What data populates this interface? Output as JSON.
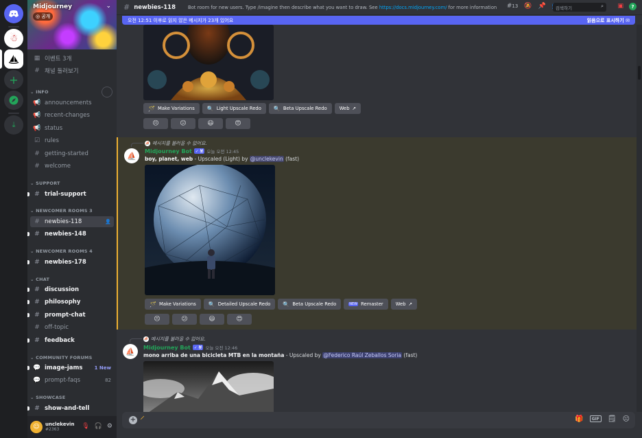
{
  "rail": {
    "icons": [
      "discord-home-icon",
      "ghost-server-icon",
      "midjourney-server-icon",
      "add-server-icon",
      "explore-icon",
      "download-icon"
    ]
  },
  "server": {
    "name": "Midjourney",
    "public_label": "공개"
  },
  "sidebar": {
    "top_items": [
      {
        "label": "이벤트 3개",
        "icon": "calendar-icon"
      },
      {
        "label": "채널 둘러보기",
        "icon": "browse-channels-icon"
      }
    ],
    "categories": {
      "info": "INFO",
      "support": "SUPPORT",
      "newcomer3": "NEWCOMER ROOMS 3",
      "newcomer4": "NEWCOMER ROOMS 4",
      "chat": "CHAT",
      "forums": "COMMUNITY FORUMS",
      "showcase": "SHOWCASE"
    },
    "info_channels": [
      "announcements",
      "recent-changes",
      "status",
      "rules",
      "getting-started",
      "welcome"
    ],
    "support_channels": [
      "trial-support"
    ],
    "newcomer3_channels": [
      "newbies-118",
      "newbies-148"
    ],
    "newcomer4_channels": [
      "newbies-178"
    ],
    "chat_channels": [
      "discussion",
      "philosophy",
      "prompt-chat",
      "off-topic",
      "feedback"
    ],
    "forum_channels": [
      {
        "name": "image-jams",
        "badge": "1 New"
      },
      {
        "name": "prompt-faqs",
        "badge": "82"
      }
    ],
    "showcase_channels": [
      "show-and-tell"
    ]
  },
  "user": {
    "name": "unclekevin",
    "tag": "#2363"
  },
  "header": {
    "channel": "newbies-118",
    "topic_prefix": "Bot room for new users. Type /imagine then describe what you want to draw. See",
    "topic_link": "https://docs.midjourney.com/",
    "topic_suffix": "for more information",
    "thread_count": "13",
    "search_placeholder": "검색하기"
  },
  "unread": {
    "text": "오전 12:51 이후로 읽지 않은 메시지가 23개 있어요",
    "mark_read": "읽음으로 표시하기"
  },
  "messages": [
    {
      "buttons": [
        "Make Variations",
        "Light Upscale Redo",
        "Beta Upscale Redo",
        "Web"
      ],
      "reactions": [
        "😣",
        "😕",
        "😃",
        "😍"
      ]
    },
    {
      "reply": "메시지를 불러올 수 없어요.",
      "author": "Midjourney Bot",
      "badge": "봇",
      "time": "오늘 오전 12:45",
      "prompt": "boy, planet, web",
      "desc": "- Upscaled (Light) by",
      "mention": "@unclekevin",
      "suffix": "(fast)",
      "buttons": [
        "Make Variations",
        "Detailed Upscale Redo",
        "Beta Upscale Redo",
        "Remaster",
        "Web"
      ],
      "reactions": [
        "😣",
        "😕",
        "😃",
        "😍"
      ]
    },
    {
      "reply": "메시지를 불러올 수 없어요.",
      "author": "Midjourney Bot",
      "badge": "봇",
      "time": "오늘 오전 12:46",
      "prompt": "mono arriba de una bicicleta MTB en la montaña",
      "desc": "- Upscaled by",
      "mention": "@Federico Raúl Zeballos Soria",
      "suffix": "(fast)"
    }
  ]
}
